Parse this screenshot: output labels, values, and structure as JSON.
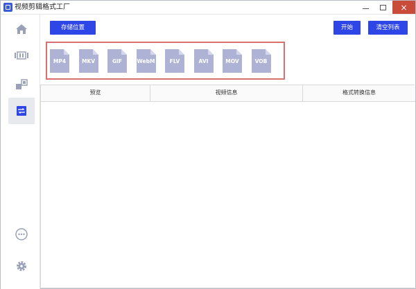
{
  "window": {
    "title": "视频剪辑格式工厂",
    "close_glyph": "×"
  },
  "sidebar": {
    "items": [
      {
        "name": "home-icon"
      },
      {
        "name": "clip-icon"
      },
      {
        "name": "merge-icon"
      },
      {
        "name": "convert-icon"
      },
      {
        "name": "more-icon"
      },
      {
        "name": "gear-icon"
      }
    ],
    "active_index": 3
  },
  "toolbar": {
    "save_label": "存储位置",
    "start_label": "开始",
    "clear_label": "清空列表"
  },
  "formats": [
    "MP4",
    "MKV",
    "GIF",
    "WebM",
    "FLV",
    "AVI",
    "MOV",
    "VOB"
  ],
  "table": {
    "headers": [
      "预览",
      "视频信息",
      "格式转换信息"
    ]
  },
  "colors": {
    "accent": "#2f46e6",
    "format_icon": "#aeb3d6",
    "highlight_box": "#d9706b"
  }
}
